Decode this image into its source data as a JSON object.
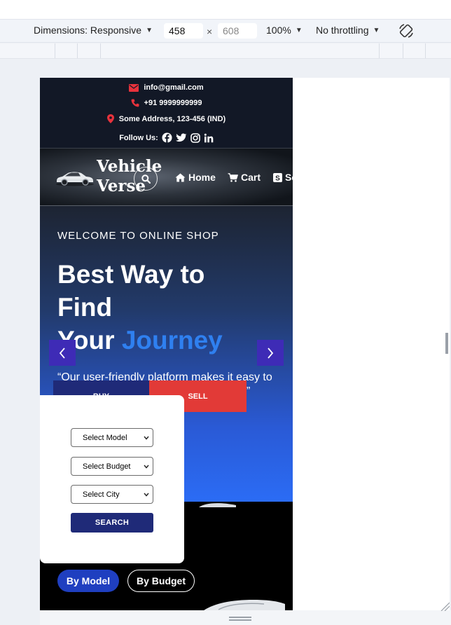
{
  "devtools": {
    "dimensions_label": "Dimensions: Responsive",
    "width_value": "458",
    "height_placeholder": "608",
    "times": "×",
    "zoom": "100%",
    "throttling": "No throttling"
  },
  "contact": {
    "email": "info@gmail.com",
    "phone": "+91 9999999999",
    "address": "Some Address, 123-456 (IND)",
    "follow_label": "Follow Us:"
  },
  "nav": {
    "brand_line1": "Vehicle",
    "brand_line2": "Verse",
    "home": "Home",
    "cart": "Cart",
    "sell_partial": "Se"
  },
  "hero": {
    "welcome": "WELCOME TO ONLINE SHOP",
    "headline_line1": "Best Way to",
    "headline_line2": "Find",
    "headline_line3_a": "Your",
    "headline_line3_b": "Journey",
    "quote_line1": "“Our user-friendly platform makes it easy to",
    "quote_line2": "”"
  },
  "search_form": {
    "tab_buy": "BUY",
    "tab_sell": "SELL",
    "select_model": "Select Model",
    "select_budget": "Select Budget",
    "select_city": "Select City",
    "search_button": "SEARCH"
  },
  "filters": {
    "by_model": "By Model",
    "by_budget": "By Budget"
  },
  "colors": {
    "accent_blue": "#2f80f0",
    "buy_tab": "#1f2a78",
    "sell_tab": "#e23a37",
    "slider_button": "#3e2bb6",
    "icon_red": "#e8323c"
  }
}
